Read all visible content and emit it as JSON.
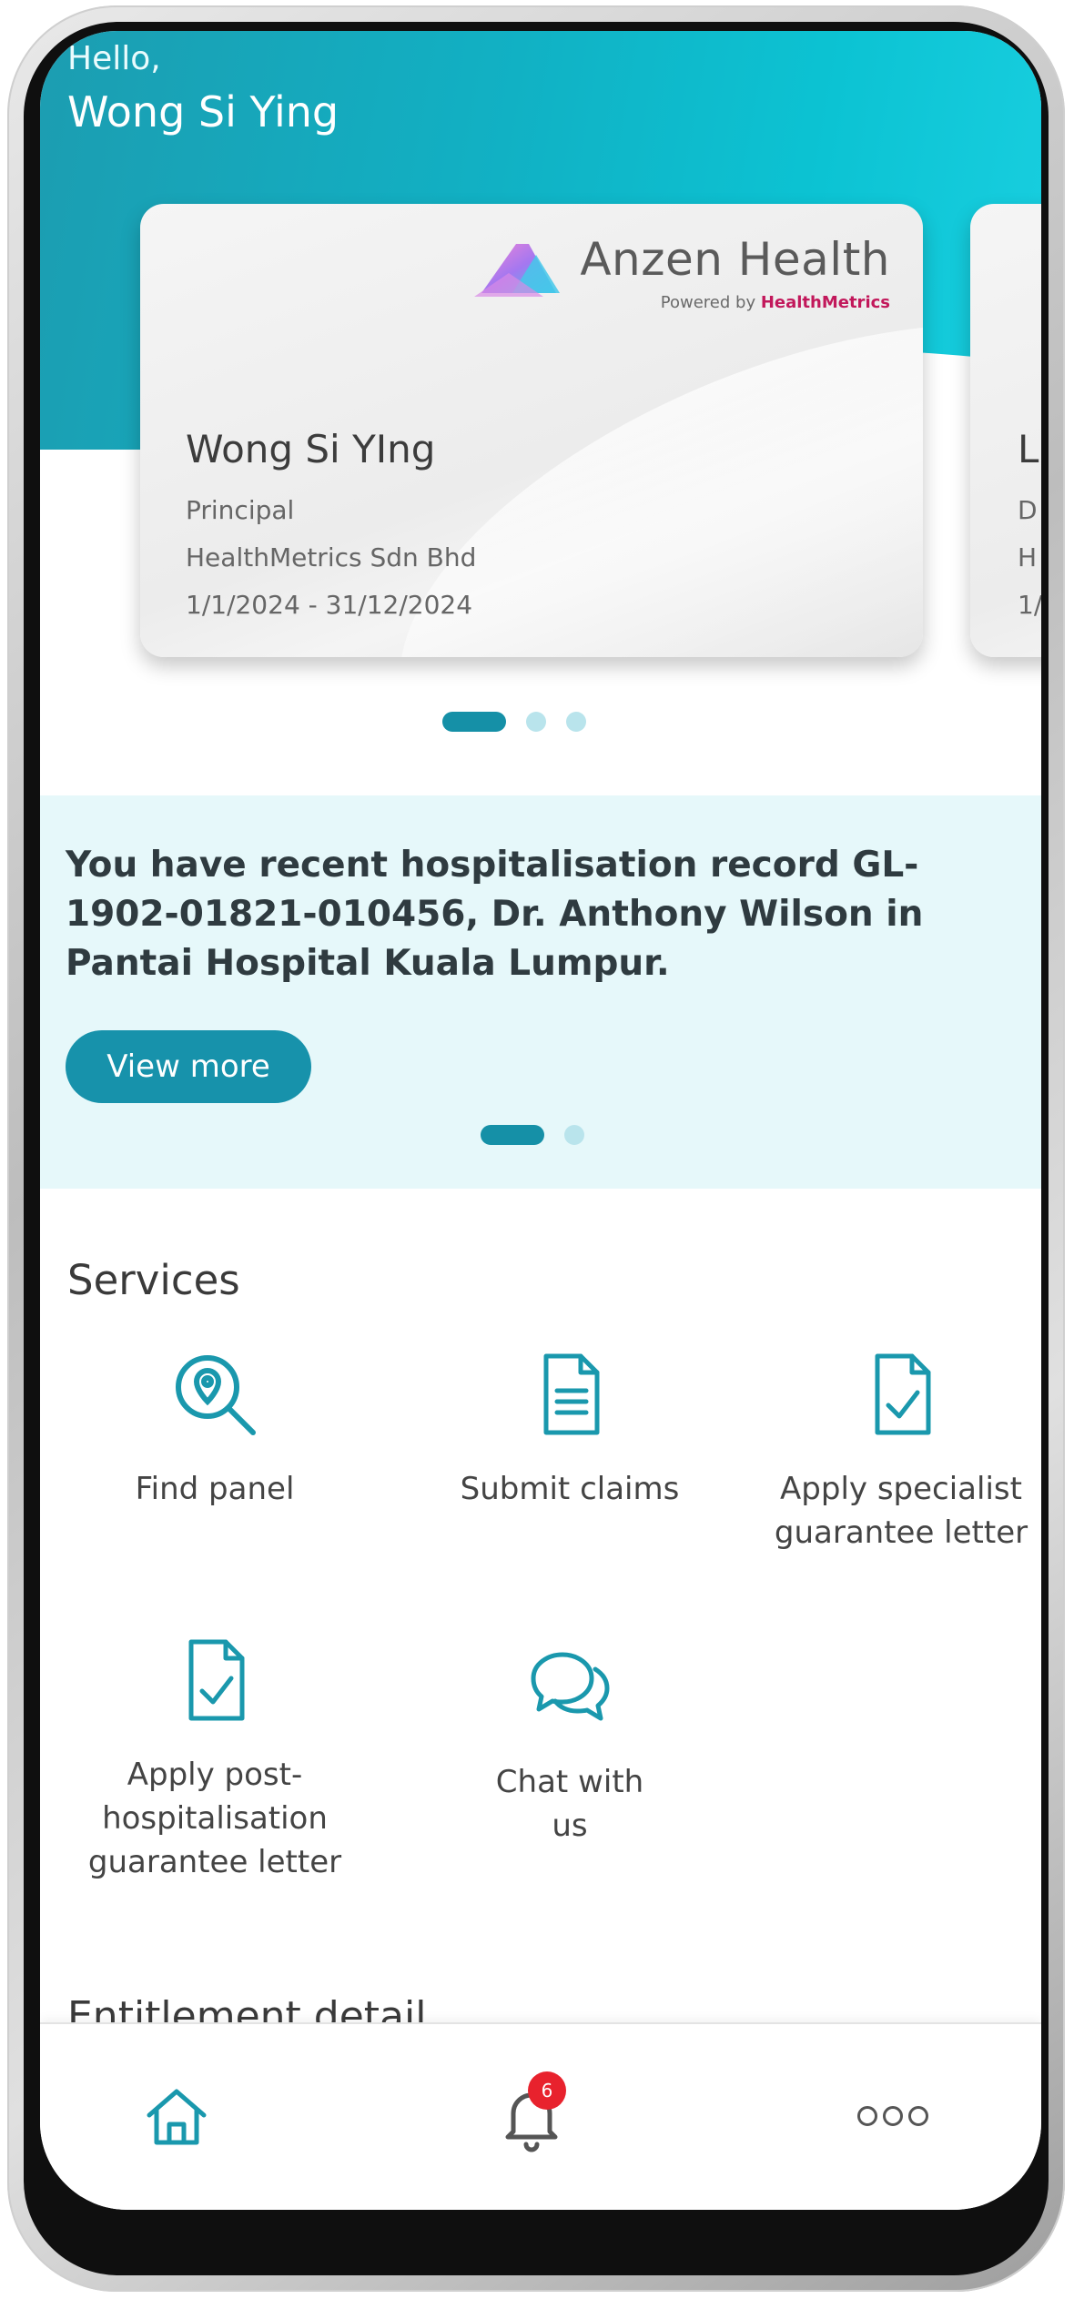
{
  "header": {
    "greeting": "Hello,",
    "user_name": "Wong Si Ying"
  },
  "cards": [
    {
      "brand_name": "Anzen Health",
      "brand_sub_prefix": "Powered by ",
      "brand_sub_company": "HealthMetrics",
      "holder_name": "Wong Si YIng",
      "role": "Principal",
      "company": "HealthMetrics Sdn Bhd",
      "period": "1/1/2024 - 31/12/2024"
    },
    {
      "holder_name": "L",
      "role": "D",
      "company": "H",
      "period": "1/"
    }
  ],
  "card_pager": {
    "count": 3,
    "active_index": 0
  },
  "banner": {
    "message": "You have recent hospitalisation record GL-1902-01821-010456, Dr. Anthony Wilson in Pantai Hospital Kuala Lumpur.",
    "button_label": "View more",
    "pager_count": 2,
    "pager_active_index": 0
  },
  "services": {
    "title": "Services",
    "items": [
      {
        "label_lines": [
          "Find panel"
        ],
        "icon": "location-search-icon"
      },
      {
        "label_lines": [
          "Submit claims"
        ],
        "icon": "document-icon"
      },
      {
        "label_lines": [
          "Apply specialist",
          "guarantee letter"
        ],
        "icon": "document-check-icon"
      },
      {
        "label_lines": [
          "Apply post-",
          "hospitalisation",
          "guarantee letter"
        ],
        "icon": "document-check-icon"
      },
      {
        "label_lines": [
          "Chat with",
          "us"
        ],
        "icon": "chat-bubbles-icon"
      }
    ]
  },
  "entitlement": {
    "title": "Entitlement detail"
  },
  "bottom_nav": {
    "items": [
      {
        "name": "home",
        "icon": "home-icon",
        "active": true
      },
      {
        "name": "notifications",
        "icon": "bell-icon",
        "badge": "6"
      },
      {
        "name": "more",
        "icon": "more-icon"
      }
    ]
  },
  "colors": {
    "accent": "#1792ab",
    "hero_gradient_start": "#1c9db1",
    "hero_gradient_end": "#19cfe0",
    "banner_bg": "#e6f8fa",
    "badge": "#e8222d"
  }
}
